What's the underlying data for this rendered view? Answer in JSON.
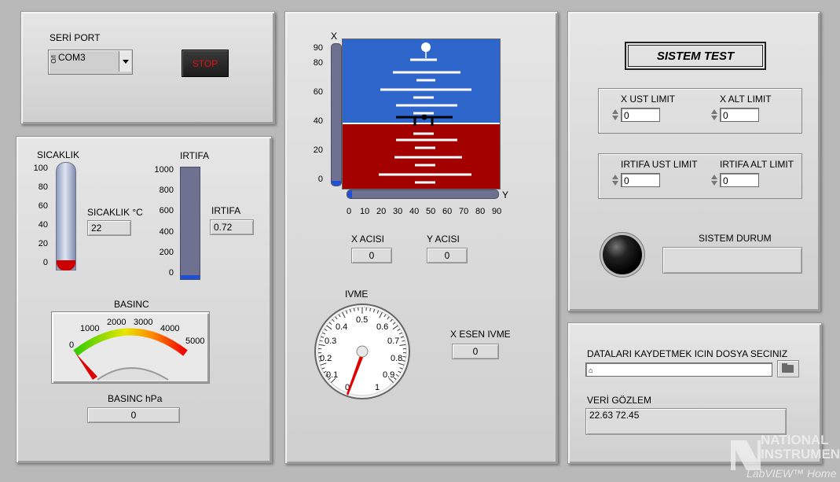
{
  "serial": {
    "label": "SERİ PORT",
    "prefix": "I/O",
    "value": "COM3",
    "stop_label": "STOP"
  },
  "sicaklik": {
    "title": "SICAKLIK",
    "ticks": [
      "100",
      "80",
      "60",
      "40",
      "20",
      "0"
    ],
    "readout_label": "SICAKLIK °C",
    "readout": "22",
    "level": 0.02,
    "fill_color": "#cc0000"
  },
  "irtifa": {
    "title": "IRTIFA",
    "ticks": [
      "1000",
      "800",
      "600",
      "400",
      "200",
      "0"
    ],
    "readout_label": "IRTIFA",
    "readout": "0.72",
    "level": 0.0007,
    "fill_color": "#1f4fd6"
  },
  "basinc": {
    "title": "BASINC",
    "scale": [
      "0",
      "1000",
      "2000",
      "3000",
      "4000",
      "5000"
    ],
    "readout_label": "BASINC hPa",
    "readout": "0",
    "value": 0
  },
  "horizon": {
    "x_axis_label": "X",
    "y_axis_label": "Y",
    "x_ticks": [
      "90",
      "80",
      "60",
      "40",
      "20",
      "0"
    ],
    "y_ticks": [
      "0",
      "10",
      "20",
      "30",
      "40",
      "50",
      "60",
      "70",
      "80",
      "90"
    ],
    "sky_color": "#2f66cc",
    "ground_color": "#a30000"
  },
  "angles": {
    "x_label": "X ACISI",
    "x_value": "0",
    "y_label": "Y ACISI",
    "y_value": "0"
  },
  "ivme": {
    "title": "IVME",
    "ticks": [
      "0",
      "0.1",
      "0.2",
      "0.3",
      "0.4",
      "0.5",
      "0.6",
      "0.7",
      "0.8",
      "0.9",
      "1"
    ],
    "value": 0,
    "esen_label": "X ESEN IVME",
    "esen_value": "0"
  },
  "sistem": {
    "title": "SISTEM TEST",
    "x_ust_label": "X UST LIMIT",
    "x_ust_value": "0",
    "x_alt_label": "X ALT  LIMIT",
    "x_alt_value": "0",
    "irtifa_ust_label": "IRTIFA UST LIMIT",
    "irtifa_ust_value": "0",
    "irtifa_alt_label": "IRTIFA ALT  LIMIT",
    "irtifa_alt_value": "0",
    "durum_label": "SISTEM DURUM",
    "durum_value": ""
  },
  "data": {
    "file_label": "DATALARI KAYDETMEK ICIN DOSYA SECINIZ",
    "file_value": "",
    "gozlem_label": "VERİ GÖZLEM",
    "gozlem_value": "22.63 72.45"
  },
  "brand": {
    "line1": "NATIONAL",
    "line2": "INSTRUMENTS",
    "line3": "LabVIEW™ Home"
  }
}
